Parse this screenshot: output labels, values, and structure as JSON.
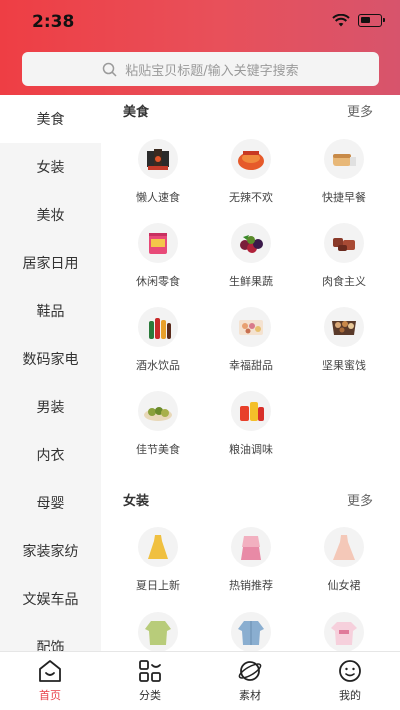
{
  "status": {
    "time": "2:38"
  },
  "search": {
    "placeholder": "粘贴宝贝标题/输入关键字搜索"
  },
  "sidebar": {
    "items": [
      {
        "label": "美食"
      },
      {
        "label": "女装"
      },
      {
        "label": "美妆"
      },
      {
        "label": "居家日用"
      },
      {
        "label": "鞋品"
      },
      {
        "label": "数码家电"
      },
      {
        "label": "男装"
      },
      {
        "label": "内衣"
      },
      {
        "label": "母婴"
      },
      {
        "label": "家装家纺"
      },
      {
        "label": "文娱车品"
      },
      {
        "label": "配饰"
      }
    ]
  },
  "sections": [
    {
      "title": "美食",
      "more": "更多",
      "items": [
        {
          "label": "懒人速食",
          "icon": "instant-food-icon"
        },
        {
          "label": "无辣不欢",
          "icon": "spicy-food-icon"
        },
        {
          "label": "快捷早餐",
          "icon": "breakfast-icon"
        },
        {
          "label": "休闲零食",
          "icon": "snack-icon"
        },
        {
          "label": "生鲜果蔬",
          "icon": "fresh-fruit-icon"
        },
        {
          "label": "肉食主义",
          "icon": "meat-icon"
        },
        {
          "label": "酒水饮品",
          "icon": "drinks-icon"
        },
        {
          "label": "幸福甜品",
          "icon": "dessert-icon"
        },
        {
          "label": "坚果蜜饯",
          "icon": "nuts-icon"
        },
        {
          "label": "佳节美食",
          "icon": "festival-food-icon"
        },
        {
          "label": "粮油调味",
          "icon": "grain-oil-icon"
        }
      ]
    },
    {
      "title": "女装",
      "more": "更多",
      "items": [
        {
          "label": "夏日上新",
          "icon": "yellow-dress-icon"
        },
        {
          "label": "热销推荐",
          "icon": "pink-outfit-icon"
        },
        {
          "label": "仙女裙",
          "icon": "fairy-dress-icon"
        },
        {
          "label": "",
          "icon": "green-sweater-icon"
        },
        {
          "label": "",
          "icon": "denim-jacket-icon"
        },
        {
          "label": "",
          "icon": "pink-tshirt-icon"
        }
      ]
    }
  ],
  "tabbar": {
    "items": [
      {
        "label": "首页",
        "icon": "home-icon",
        "active": true
      },
      {
        "label": "分类",
        "icon": "category-icon"
      },
      {
        "label": "素材",
        "icon": "planet-icon"
      },
      {
        "label": "我的",
        "icon": "profile-icon"
      }
    ],
    "active_color": "#e8404a"
  },
  "colors": {
    "header_start": "#ee3e44",
    "header_end": "#d7546c",
    "accent": "#e8404a"
  }
}
